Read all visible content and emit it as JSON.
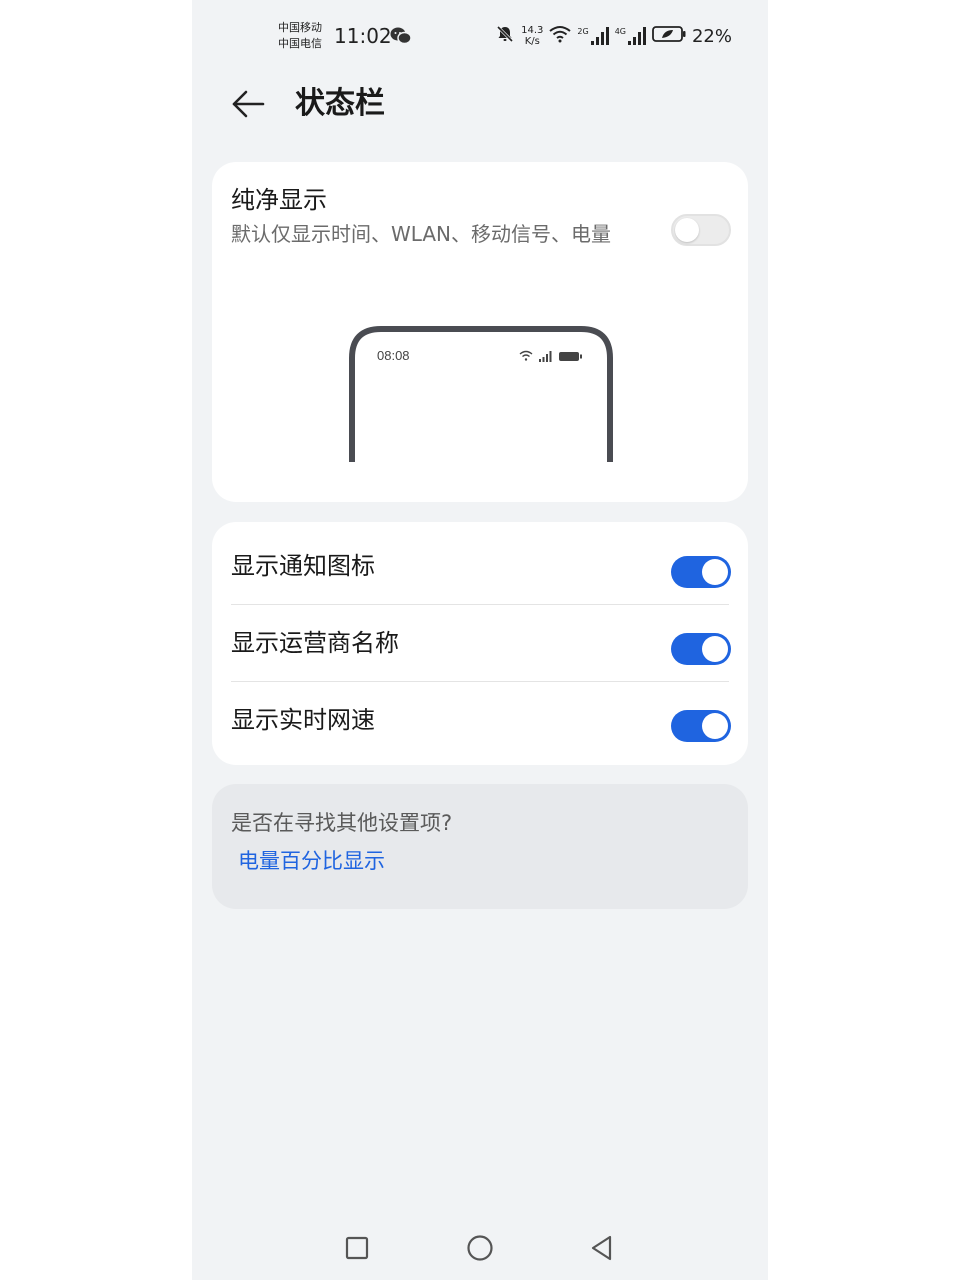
{
  "status_bar": {
    "carrier_1": "中国移动",
    "carrier_2": "中国电信",
    "time": "11:02",
    "net_speed_value": "14.3",
    "net_speed_unit": "K/s",
    "signal_1_tag": "2G",
    "signal_2_tag": "4G",
    "battery_percent": "22%",
    "icons": [
      "wechat-icon",
      "mute-bell-icon",
      "wifi-icon",
      "signal-icon",
      "signal-icon",
      "battery-icon"
    ]
  },
  "header": {
    "back_icon": "arrow-left-icon",
    "title": "状态栏"
  },
  "pure_display": {
    "title": "纯净显示",
    "description": "默认仅显示时间、WLAN、移动信号、电量",
    "toggle_on": false,
    "preview_time": "08:08"
  },
  "settings": [
    {
      "label": "显示通知图标",
      "toggle_on": true
    },
    {
      "label": "显示运营商名称",
      "toggle_on": true
    },
    {
      "label": "显示实时网速",
      "toggle_on": true
    }
  ],
  "suggestion": {
    "question": "是否在寻找其他设置项?",
    "link": "电量百分比显示"
  },
  "nav_bar": {
    "icons": [
      "recents-square-icon",
      "home-circle-icon",
      "back-triangle-icon"
    ]
  },
  "colors": {
    "background": "#f1f3f5",
    "card": "#ffffff",
    "accent": "#1f64e0",
    "suggestion_card": "#e7e9ec"
  }
}
